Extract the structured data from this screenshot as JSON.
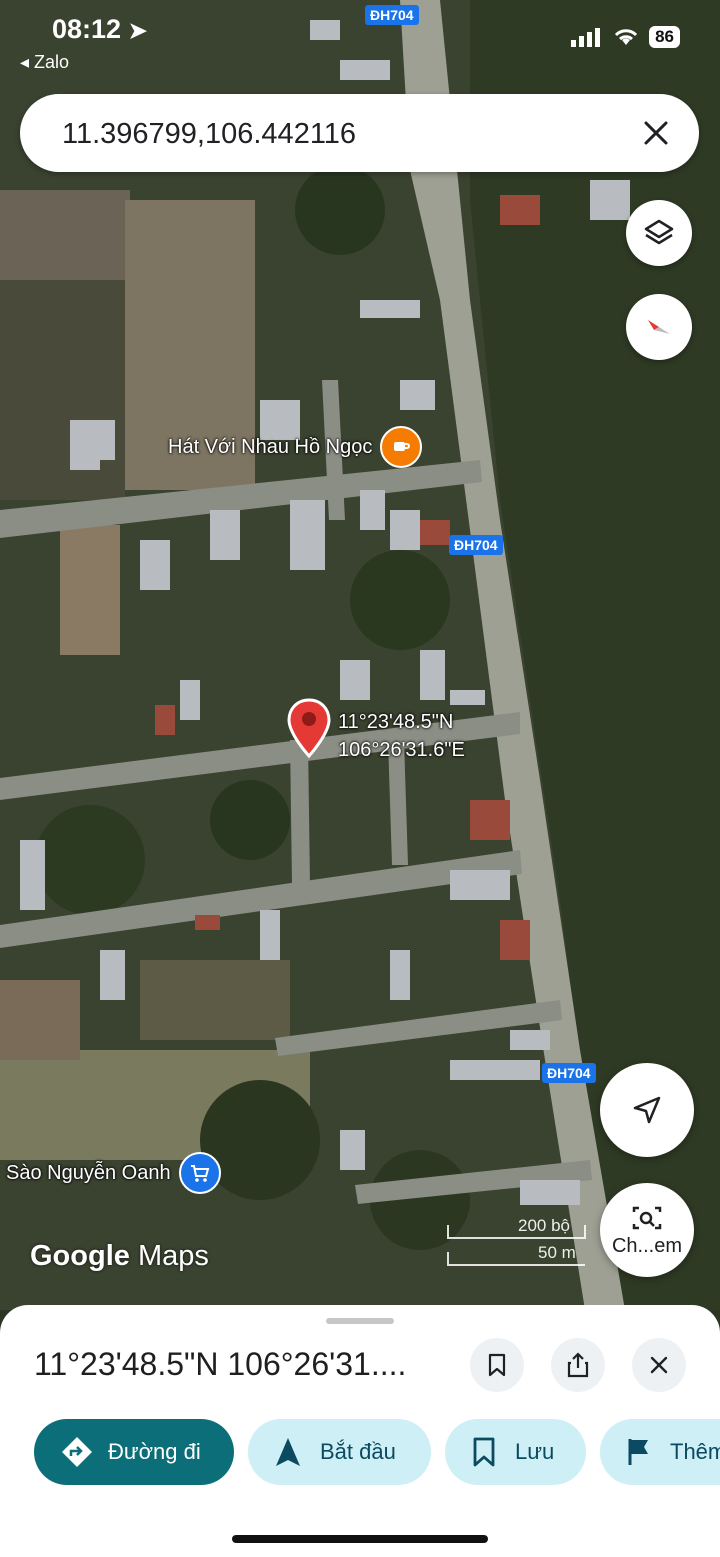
{
  "status_bar": {
    "time": "08:12",
    "back_app": "◂ Zalo",
    "battery": "86"
  },
  "search": {
    "value": "11.396799,106.442116"
  },
  "map": {
    "road_tags": [
      "ĐH704",
      "ĐH704",
      "ĐH704"
    ],
    "places": [
      {
        "name": "Hát Với Nhau Hồ Ngọc",
        "icon": "cafe-icon",
        "color": "#f57c00"
      },
      {
        "name": "Sào Nguyễn Oanh",
        "icon": "shopping-cart-icon",
        "color": "#1a73e8"
      }
    ],
    "pin_label": {
      "lat": "11°23'48.5\"N",
      "lng": "106°26'31.6\"E"
    },
    "brand": {
      "google": "Google",
      "maps": "Maps"
    },
    "scale": {
      "imperial": "200 bộ",
      "metric": "50 m"
    },
    "lens_label": "Ch...em"
  },
  "sheet": {
    "title": "11°23'48.5\"N 106°26'31....",
    "chips": [
      {
        "label": "Đường đi",
        "icon": "directions-icon"
      },
      {
        "label": "Bắt đầu",
        "icon": "navigation-arrow-icon"
      },
      {
        "label": "Lưu",
        "icon": "bookmark-icon"
      },
      {
        "label": "Thêm",
        "icon": "flag-icon"
      }
    ]
  },
  "colors": {
    "accent": "#0b6e78",
    "chip_bg": "#cdeff5",
    "pin": "#e53935"
  }
}
